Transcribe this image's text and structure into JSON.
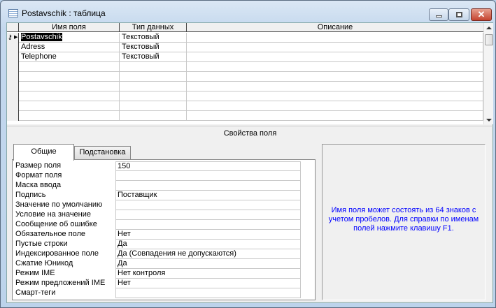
{
  "window": {
    "title": "Postavschik : таблица",
    "minimize": "",
    "maximize": "",
    "close": "✕"
  },
  "grid": {
    "headers": [
      "Имя поля",
      "Тип данных",
      "Описание"
    ],
    "rows": [
      {
        "name": "Postavschik",
        "type": "Текстовый",
        "desc": "",
        "key": true
      },
      {
        "name": "Adress",
        "type": "Текстовый",
        "desc": ""
      },
      {
        "name": "Telephone",
        "type": "Текстовый",
        "desc": ""
      }
    ],
    "empty_rows": 6
  },
  "section_label": "Свойства поля",
  "tabs": [
    "Общие",
    "Подстановка"
  ],
  "properties": [
    {
      "label": "Размер поля",
      "value": "150"
    },
    {
      "label": "Формат поля",
      "value": ""
    },
    {
      "label": "Маска ввода",
      "value": ""
    },
    {
      "label": "Подпись",
      "value": "Поставщик"
    },
    {
      "label": "Значение по умолчанию",
      "value": ""
    },
    {
      "label": "Условие на значение",
      "value": ""
    },
    {
      "label": "Сообщение об ошибке",
      "value": ""
    },
    {
      "label": "Обязательное поле",
      "value": "Нет"
    },
    {
      "label": "Пустые строки",
      "value": "Да"
    },
    {
      "label": "Индексированное поле",
      "value": "Да (Совпадения не допускаются)"
    },
    {
      "label": "Сжатие Юникод",
      "value": "Да"
    },
    {
      "label": "Режим IME",
      "value": "Нет контроля"
    },
    {
      "label": "Режим предложений IME",
      "value": "Нет"
    },
    {
      "label": "Смарт-теги",
      "value": ""
    }
  ],
  "help_text": "Имя поля может состоять из 64 знаков с учетом пробелов.  Для справки по именам полей нажмите клавишу F1.",
  "colors": {
    "help": "#0000ff",
    "frame": "#c4d8ee"
  }
}
